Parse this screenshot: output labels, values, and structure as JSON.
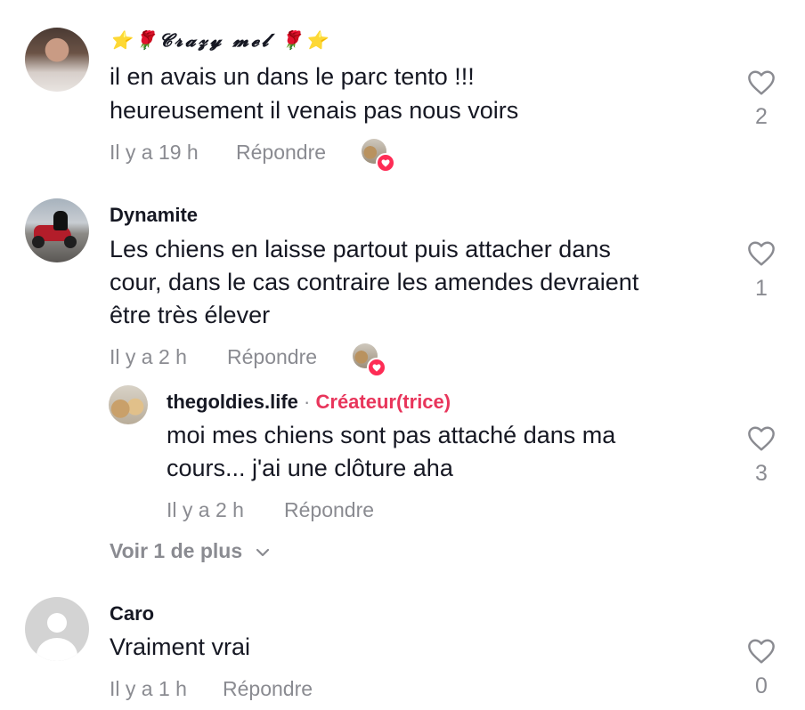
{
  "comments": [
    {
      "user": "⭐🌹𝓒𝓻𝓪𝔃𝔂 𝓶𝓮𝓵 🌹⭐",
      "text_lines": [
        "il en avais un dans le parc tento !!!",
        "heureusement il venais pas nous voirs"
      ],
      "time": "Il y a 19 h",
      "reply": "Répondre",
      "likes": "2",
      "avatar": "woman-photo-avatar",
      "creator_liked": true
    },
    {
      "user": "Dynamite",
      "text_lines": [
        "Les chiens en laisse partout puis attacher dans",
        "cour, dans le cas contraire les amendes devraient",
        "être très élever"
      ],
      "time": "Il y a 2 h",
      "reply": "Répondre",
      "likes": "1",
      "avatar": "motorcycle-avatar",
      "creator_liked": true,
      "replies": [
        {
          "user": "thegoldies.life",
          "separator": "·",
          "badge": "Créateur(trice)",
          "text_lines": [
            "moi mes chiens sont pas attaché dans ma",
            "cours... j'ai une clôture aha"
          ],
          "time": "Il y a 2 h",
          "reply": "Répondre",
          "likes": "3",
          "avatar": "dogs-avatar"
        }
      ],
      "more_replies": "Voir 1 de plus"
    },
    {
      "user": "Caro",
      "text_lines": [
        "Vraiment vrai"
      ],
      "time": "Il y a 1 h",
      "reply": "Répondre",
      "likes": "0",
      "avatar": "default-avatar"
    }
  ],
  "icons": {
    "like": "heart-outline-icon",
    "chevron": "chevron-down-icon",
    "creator_like_badge": "heart-filled-icon"
  },
  "colors": {
    "text": "#161823",
    "muted": "#8a8b91",
    "creator": "#e8355b",
    "like_badge": "#fe2c55"
  }
}
